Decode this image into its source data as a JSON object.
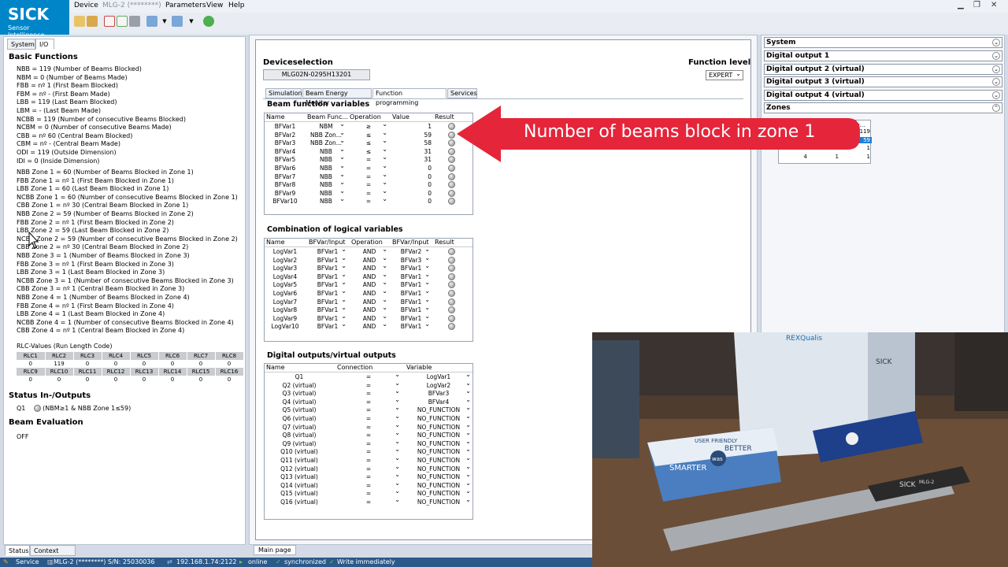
{
  "app": {
    "logo_brand": "SICK",
    "logo_tagline": "Sensor Intelligence.",
    "menu": [
      "Device",
      "MLG-2 (********)",
      "Parameters",
      "View",
      "Help"
    ]
  },
  "left": {
    "tabs": [
      "System",
      "I/O"
    ],
    "basic_title": "Basic Functions",
    "basic_lines": [
      "NBB = 119 (Number of Beams Blocked)",
      "NBM = 0 (Number of Beams Made)",
      "FBB = nº 1 (First Beam Blocked)",
      "FBM = nº - (First Beam Made)",
      "LBB = 119 (Last Beam Blocked)",
      "LBM = - (Last Beam Made)",
      "NCBB = 119 (Number of consecutive Beams Blocked)",
      "NCBM = 0 (Number of consecutive Beams Made)",
      "CBB = nº 60 (Central Beam Blocked)",
      "CBM = nº - (Central Beam Made)",
      "ODI = 119 (Outside Dimension)",
      "IDI = 0 (Inside Dimension)"
    ],
    "zone_lines": [
      "NBB Zone 1 = 60 (Number of Beams Blocked in Zone 1)",
      "FBB Zone 1 = nº 1 (First Beam Blocked in Zone 1)",
      "LBB Zone 1 = 60 (Last Beam Blocked in Zone 1)",
      "NCBB Zone 1 = 60 (Number of consecutive Beams Blocked in Zone 1)",
      "CBB Zone 1 = nº 30 (Central Beam Blocked in Zone 1)",
      "NBB Zone 2 = 59 (Number of Beams Blocked in Zone 2)",
      "FBB Zone 2 = nº 1 (First Beam Blocked in Zone 2)",
      "LBB Zone 2 = 59 (Last Beam Blocked in Zone 2)",
      "NCBB Zone 2 = 59 (Number of consecutive Beams Blocked in Zone 2)",
      "CBB Zone 2 = nº 30 (Central Beam Blocked in Zone 2)",
      "NBB Zone 3 = 1 (Number of Beams Blocked in Zone 3)",
      "FBB Zone 3 = nº 1 (First Beam Blocked in Zone 3)",
      "LBB Zone 3 = 1 (Last Beam Blocked in Zone 3)",
      "NCBB Zone 3 = 1 (Number of consecutive Beams Blocked in Zone 3)",
      "CBB Zone 3 = nº 1 (Central Beam Blocked in Zone 3)",
      "NBB Zone 4 = 1 (Number of Beams Blocked in Zone 4)",
      "FBB Zone 4 = nº 1 (First Beam Blocked in Zone 4)",
      "LBB Zone 4 = 1 (Last Beam Blocked in Zone 4)",
      "NCBB Zone 4 = 1 (Number of consecutive Beams Blocked in Zone 4)",
      "CBB Zone 4 = nº 1 (Central Beam Blocked in Zone 4)"
    ],
    "rlc_title": "RLC-Values (Run Length Code)",
    "rlc_head1": [
      "RLC1",
      "RLC2",
      "RLC3",
      "RLC4",
      "RLC5",
      "RLC6",
      "RLC7",
      "RLC8"
    ],
    "rlc_vals1": [
      "0",
      "119",
      "0",
      "0",
      "0",
      "0",
      "0",
      "0"
    ],
    "rlc_head2": [
      "RLC9",
      "RLC10",
      "RLC11",
      "RLC12",
      "RLC13",
      "RLC14",
      "RLC15",
      "RLC16"
    ],
    "rlc_vals2": [
      "0",
      "0",
      "0",
      "0",
      "0",
      "0",
      "0",
      "0"
    ],
    "status_title": "Status In-/Outputs",
    "q1_label": "Q1",
    "q1_expr": "(NBM≥1 & NBB Zone 1≤59)",
    "beam_eval_title": "Beam Evaluation",
    "beam_eval_value": "OFF",
    "bottom_tabs": [
      "Status",
      "Context Help"
    ]
  },
  "middle": {
    "device_title": "Deviceselection",
    "device_button": "MLG02N-0295H13201",
    "function_level_label": "Function level",
    "function_level_value": "EXPERT",
    "tabs": [
      "Simulation",
      "Beam Energy Monitor",
      "Function programming",
      "Services"
    ],
    "bf_title": "Beam function variables",
    "bf_headers": [
      "Name",
      "Beam Func...",
      "Operation",
      "Value",
      "Result"
    ],
    "bf_rows": [
      [
        "BFVar1",
        "NBM",
        "≥",
        "1"
      ],
      [
        "BFVar2",
        "NBB Zon...",
        "≤",
        "59"
      ],
      [
        "BFVar3",
        "NBB Zon...",
        "≤",
        "58"
      ],
      [
        "BFVar4",
        "NBB",
        "≤",
        "31"
      ],
      [
        "BFVar5",
        "NBB",
        "=",
        "31"
      ],
      [
        "BFVar6",
        "NBB",
        "=",
        "0"
      ],
      [
        "BFVar7",
        "NBB",
        "=",
        "0"
      ],
      [
        "BFVar8",
        "NBB",
        "=",
        "0"
      ],
      [
        "BFVar9",
        "NBB",
        "=",
        "0"
      ],
      [
        "BFVar10",
        "NBB",
        "=",
        "0"
      ]
    ],
    "log_title": "Combination of logical variables",
    "log_headers": [
      "Name",
      "BFVar/Input",
      "Operation",
      "BFVar/Input",
      "Result"
    ],
    "log_rows": [
      [
        "LogVar1",
        "BFVar1",
        "AND",
        "BFVar2"
      ],
      [
        "LogVar2",
        "BFVar1",
        "AND",
        "BFVar3"
      ],
      [
        "LogVar3",
        "BFVar1",
        "AND",
        "BFVar1"
      ],
      [
        "LogVar4",
        "BFVar1",
        "AND",
        "BFVar1"
      ],
      [
        "LogVar5",
        "BFVar1",
        "AND",
        "BFVar1"
      ],
      [
        "LogVar6",
        "BFVar1",
        "AND",
        "BFVar1"
      ],
      [
        "LogVar7",
        "BFVar1",
        "AND",
        "BFVar1"
      ],
      [
        "LogVar8",
        "BFVar1",
        "AND",
        "BFVar1"
      ],
      [
        "LogVar9",
        "BFVar1",
        "AND",
        "BFVar1"
      ],
      [
        "LogVar10",
        "BFVar1",
        "AND",
        "BFVar1"
      ]
    ],
    "out_title": "Digital outputs/virtual outputs",
    "out_headers": [
      "Name",
      "Connection",
      "Variable"
    ],
    "out_rows": [
      [
        "Q1",
        "=",
        "LogVar1"
      ],
      [
        "Q2 (virtual)",
        "=",
        "LogVar2"
      ],
      [
        "Q3 (virtual)",
        "=",
        "BFVar3"
      ],
      [
        "Q4 (virtual)",
        "=",
        "BFVar4"
      ],
      [
        "Q5 (virtual)",
        "=",
        "NO_FUNCTION"
      ],
      [
        "Q6 (virtual)",
        "=",
        "NO_FUNCTION"
      ],
      [
        "Q7 (virtual)",
        "=",
        "NO_FUNCTION"
      ],
      [
        "Q8 (virtual)",
        "=",
        "NO_FUNCTION"
      ],
      [
        "Q9 (virtual)",
        "=",
        "NO_FUNCTION"
      ],
      [
        "Q10 (virtual)",
        "=",
        "NO_FUNCTION"
      ],
      [
        "Q11 (virtual)",
        "=",
        "NO_FUNCTION"
      ],
      [
        "Q12 (virtual)",
        "=",
        "NO_FUNCTION"
      ],
      [
        "Q13 (virtual)",
        "=",
        "NO_FUNCTION"
      ],
      [
        "Q14 (virtual)",
        "=",
        "NO_FUNCTION"
      ],
      [
        "Q15 (virtual)",
        "=",
        "NO_FUNCTION"
      ],
      [
        "Q16 (virtual)",
        "=",
        "NO_FUNCTION"
      ]
    ],
    "bottom_tab": "Main page"
  },
  "right": {
    "sections": [
      "System",
      "Digital output 1",
      "Digital output 2 (virtual)",
      "Digital output 3 (virtual)",
      "Digital output 4 (virtual)",
      "Zones"
    ],
    "zones_header": "be...",
    "zones_rows": [
      [
        "",
        "",
        "119"
      ],
      [
        "",
        "",
        "59"
      ],
      [
        "3",
        "1",
        "1"
      ],
      [
        "4",
        "1",
        "1"
      ]
    ]
  },
  "annotation": {
    "text": "Number of beams block in zone 1",
    "color": "#e5253a"
  },
  "statusbar": {
    "items": [
      "Service",
      "MLG-2 (********) S/N: 25030036",
      "192.168.1.74:2122",
      "online",
      "synchronized",
      "Write immediately"
    ]
  },
  "camera": {
    "box_label": "REXQualis",
    "box_brand": "SICK",
    "pack_text1": "SMARTER",
    "pack_text2": "BETTER",
    "pack_text3": "USER FRIENDLY",
    "pack_logo": "was",
    "sensor_label": "SICK",
    "sensor_model": "MLG-2"
  },
  "colors": {
    "sick_blue": "#0086c8",
    "status_bar": "#2b5a8a",
    "selected_blue": "#1e7fd6"
  }
}
